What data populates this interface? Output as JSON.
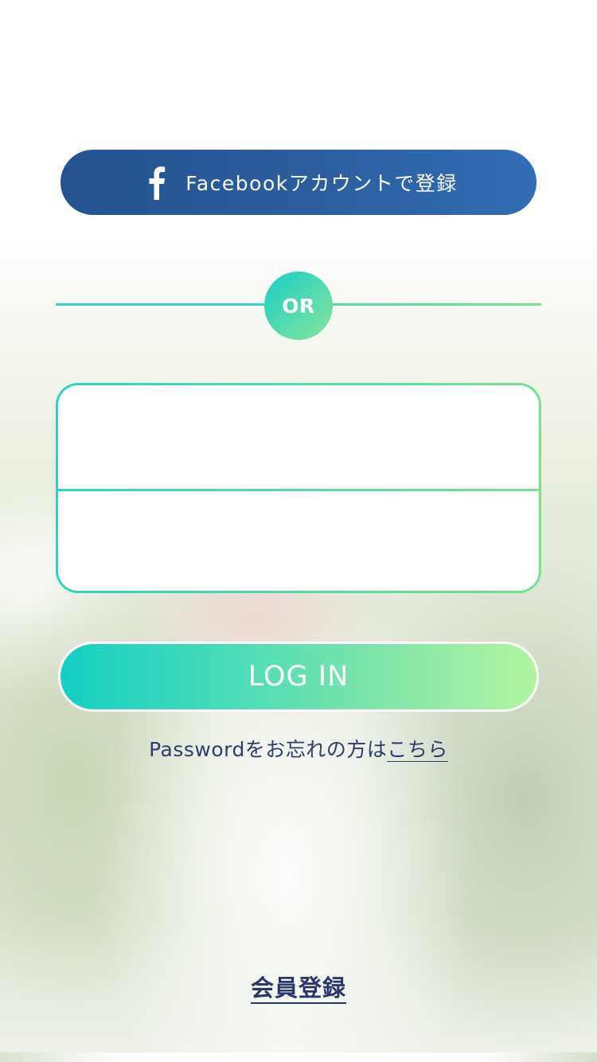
{
  "facebook": {
    "icon": "facebook-f-icon",
    "label": "Facebookアカウントで登録"
  },
  "divider": {
    "or_label": "OR"
  },
  "login_form": {
    "email_value": "",
    "password_value": ""
  },
  "login_button": {
    "label": "LOG IN"
  },
  "forgot_password": {
    "prefix": "Passwordをお忘れの方は",
    "link": "こちら"
  },
  "register": {
    "label": "会員登録"
  },
  "colors": {
    "facebook_blue": "#2c5f9f",
    "accent_teal": "#1ccec6",
    "accent_green": "#b0f59f",
    "text_navy": "#2f3c6e"
  }
}
